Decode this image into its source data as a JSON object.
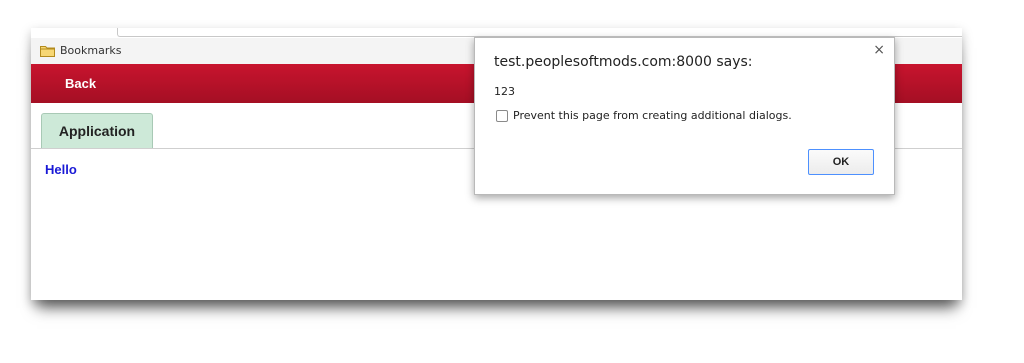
{
  "bookmarks_bar": {
    "folder_icon": "folder-icon",
    "label": "Bookmarks"
  },
  "header": {
    "back_label": "Back",
    "bar_color": "#b3112a"
  },
  "tabs": [
    {
      "label": "Application",
      "active": true,
      "color": "#cde9d8"
    }
  ],
  "main": {
    "greeting": "Hello",
    "greeting_color": "#1a1ad6"
  },
  "dialog": {
    "title": "test.peoplesoftmods.com:8000 says:",
    "message": "123",
    "checkbox_label": "Prevent this page from creating additional dialogs.",
    "checkbox_checked": false,
    "ok_label": "OK",
    "close_icon": "close-icon",
    "close_glyph": "×",
    "focus_color": "#4d90fe"
  }
}
